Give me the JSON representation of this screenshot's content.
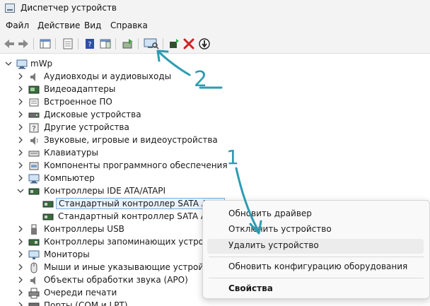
{
  "window": {
    "title": "Диспетчер устройств"
  },
  "menu": [
    "Файл",
    "Действие",
    "Вид",
    "Справка"
  ],
  "toolbar": {
    "icons": [
      "back-icon",
      "forward-icon",
      "properties-pane-icon",
      "console-tree-icon",
      "help-icon",
      "action-pane-icon",
      "update-driver-icon",
      "scan-hardware-icon",
      "add-device-icon",
      "uninstall-device-icon",
      "disable-device-icon"
    ]
  },
  "tree": {
    "root": "mWp",
    "categories": [
      "Аудиовходы и аудиовыходы",
      "Видеоадаптеры",
      "Встроенное ПО",
      "Дисковые устройства",
      "Другие устройства",
      "Звуковые, игровые и видеоустройства",
      "Клавиатуры",
      "Компоненты программного обеспечения",
      "Компьютер",
      "Контроллеры IDE ATA/ATAPI",
      "Контроллеры USB",
      "Контроллеры запоминающих устройств",
      "Мониторы",
      "Мыши и иные указывающие устройства",
      "Объекты обработки звука (APO)",
      "Очереди печати",
      "Порты (COM и LPT)"
    ],
    "children": [
      "Стандартный контроллер SATA AHCI",
      "Стандартный контроллер SATA AHCI"
    ]
  },
  "context_menu": {
    "items": [
      "Обновить драйвер",
      "Отключить устройство",
      "Удалить устройство",
      "Обновить конфигурацию оборудования",
      "Свойства"
    ]
  },
  "annotations": [
    "1",
    "2"
  ],
  "colors": {
    "accent_arrow": "#2e9bb1",
    "selection_border": "#7aaee0",
    "delete_red": "#d32020",
    "help_blue": "#2b4fa8"
  }
}
